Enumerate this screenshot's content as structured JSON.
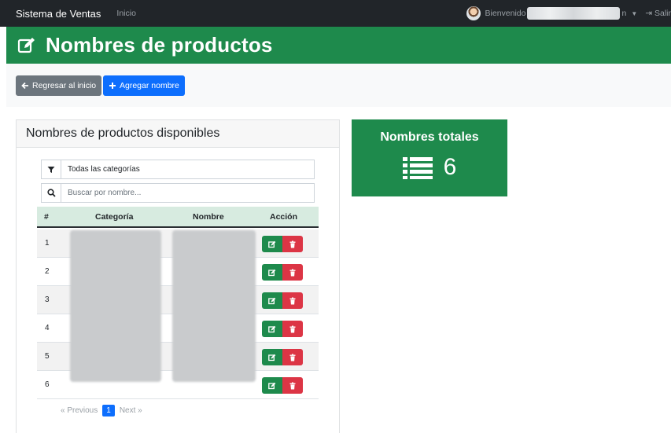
{
  "navbar": {
    "brand": "Sistema de Ventas",
    "home_link": "Inicio",
    "welcome": "Bienvenido",
    "user_suffix": "n",
    "logout": "Salir"
  },
  "header": {
    "title": "Nombres de productos"
  },
  "toolbar": {
    "back_label": "Regresar al inicio",
    "add_label": "Agregar nombre"
  },
  "card": {
    "title": "Nombres de productos disponibles",
    "filter_value": "Todas las categorías",
    "search_placeholder": "Buscar por nombre..."
  },
  "table": {
    "headers": {
      "num": "#",
      "category": "Categoría",
      "name": "Nombre",
      "action": "Acción"
    },
    "rows": [
      {
        "num": "1"
      },
      {
        "num": "2"
      },
      {
        "num": "3"
      },
      {
        "num": "4"
      },
      {
        "num": "5"
      },
      {
        "num": "6"
      }
    ]
  },
  "pagination": {
    "previous": "« Previous",
    "current": "1",
    "next": "Next »"
  },
  "totals": {
    "label": "Nombres totales",
    "value": "6"
  },
  "colors": {
    "navbar": "#212529",
    "primary_green": "#1e8a4c",
    "blue": "#0d6efd",
    "grey": "#6c757d",
    "red": "#dc3545"
  }
}
